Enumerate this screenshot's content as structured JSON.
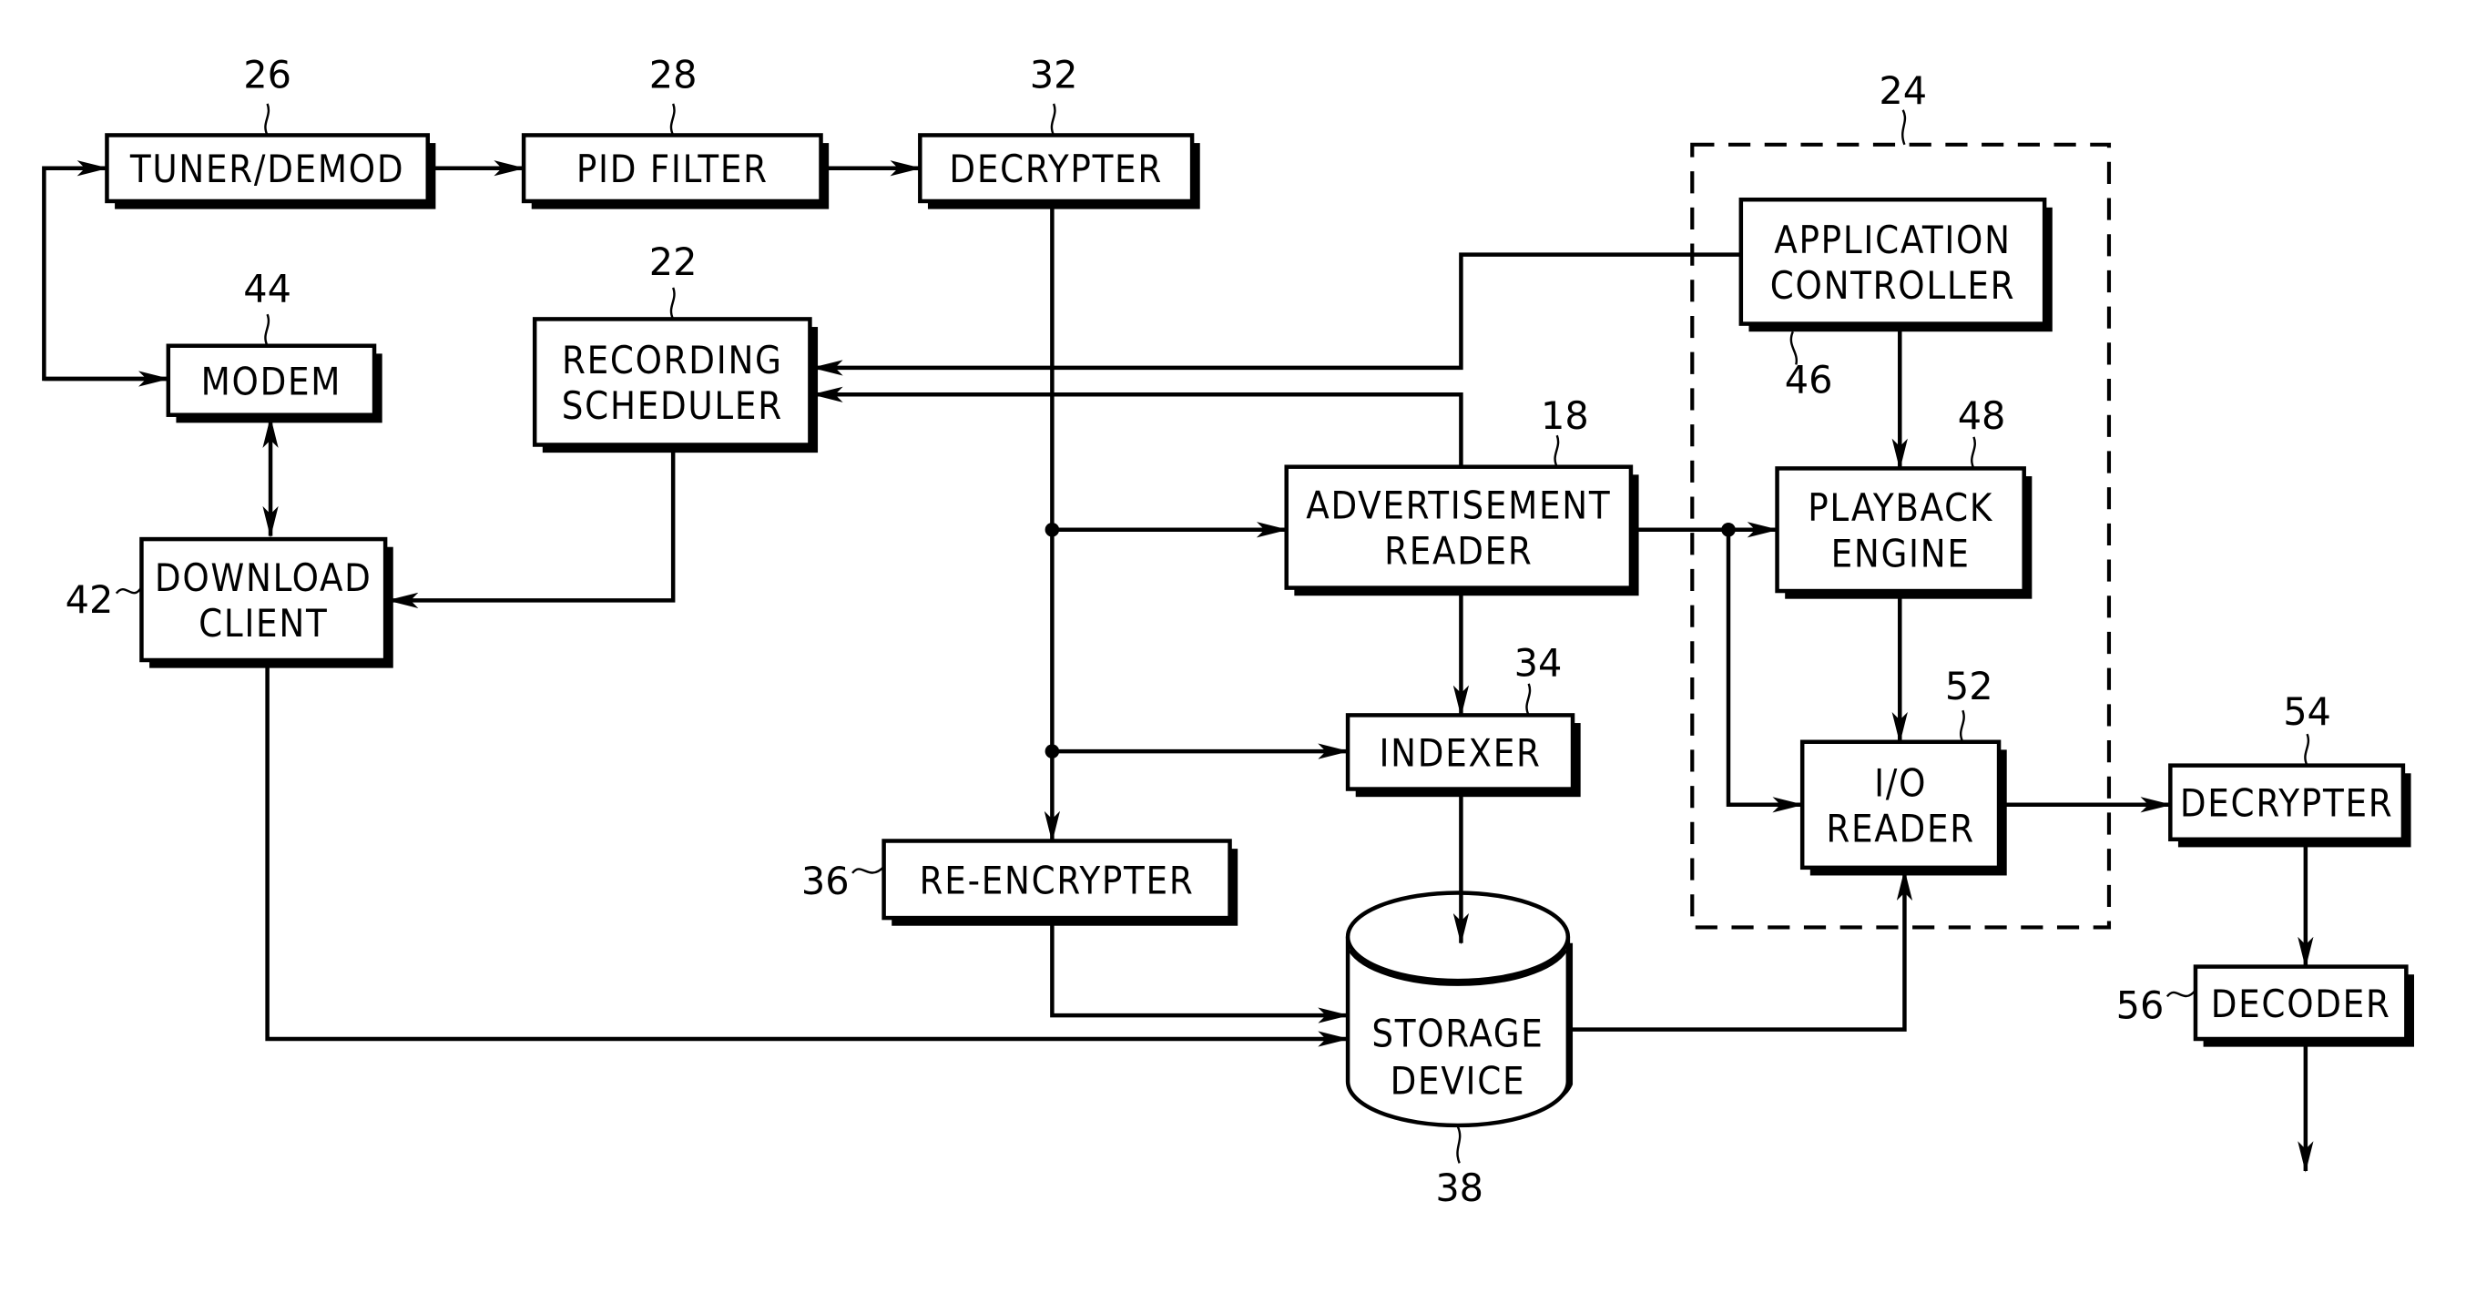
{
  "figure": {
    "blocks": [
      {
        "id": "tuner",
        "ref": "26",
        "lines": [
          "TUNER/DEMOD"
        ]
      },
      {
        "id": "pid",
        "ref": "28",
        "lines": [
          "PID FILTER"
        ]
      },
      {
        "id": "decrypter1",
        "ref": "32",
        "lines": [
          "DECRYPTER"
        ]
      },
      {
        "id": "modem",
        "ref": "44",
        "lines": [
          "MODEM"
        ]
      },
      {
        "id": "scheduler",
        "ref": "22",
        "lines": [
          "RECORDING",
          "SCHEDULER"
        ]
      },
      {
        "id": "download",
        "ref": "42",
        "lines": [
          "DOWNLOAD",
          "CLIENT"
        ]
      },
      {
        "id": "appctrl",
        "ref": "46",
        "lines": [
          "APPLICATION",
          "CONTROLLER"
        ]
      },
      {
        "id": "adreader",
        "ref": "18",
        "lines": [
          "ADVERTISEMENT",
          "READER"
        ]
      },
      {
        "id": "playback",
        "ref": "48",
        "lines": [
          "PLAYBACK",
          "ENGINE"
        ]
      },
      {
        "id": "indexer",
        "ref": "34",
        "lines": [
          "INDEXER"
        ]
      },
      {
        "id": "ioreader",
        "ref": "52",
        "lines": [
          "I/O",
          "READER"
        ]
      },
      {
        "id": "decrypter2",
        "ref": "54",
        "lines": [
          "DECRYPTER"
        ]
      },
      {
        "id": "reencrypter",
        "ref": "36",
        "lines": [
          "RE-ENCRYPTER"
        ]
      },
      {
        "id": "decoder",
        "ref": "56",
        "lines": [
          "DECODER"
        ]
      },
      {
        "id": "storage",
        "ref": "38",
        "lines": [
          "STORAGE",
          "DEVICE"
        ]
      }
    ],
    "group": {
      "ref": "24",
      "style": "dashed",
      "contains": [
        "appctrl",
        "playback",
        "ioreader"
      ]
    },
    "connections": [
      {
        "from": "tuner",
        "to": "pid",
        "arrow": "end"
      },
      {
        "from": "pid",
        "to": "decrypter1",
        "arrow": "end"
      },
      {
        "from": "modem",
        "to": "tuner",
        "arrow": "end"
      },
      {
        "from": "tuner",
        "to": "modem",
        "arrow": "end"
      },
      {
        "from": "modem",
        "to": "download",
        "arrow": "both"
      },
      {
        "from": "scheduler",
        "to": "download",
        "arrow": "end"
      },
      {
        "from": "appctrl",
        "to": "scheduler",
        "arrow": "end"
      },
      {
        "from": "adreader",
        "to": "scheduler",
        "arrow": "end"
      },
      {
        "from": "decrypter1",
        "to": "adreader",
        "arrow": "end"
      },
      {
        "from": "decrypter1",
        "to": "indexer",
        "arrow": "end"
      },
      {
        "from": "decrypter1",
        "to": "reencrypter",
        "arrow": "end"
      },
      {
        "from": "adreader",
        "to": "indexer",
        "arrow": "end"
      },
      {
        "from": "indexer",
        "to": "storage",
        "arrow": "end"
      },
      {
        "from": "reencrypter",
        "to": "storage",
        "arrow": "end"
      },
      {
        "from": "download",
        "to": "storage",
        "arrow": "end"
      },
      {
        "from": "appctrl",
        "to": "playback",
        "arrow": "end"
      },
      {
        "from": "adreader",
        "to": "playback",
        "arrow": "end"
      },
      {
        "from": "adreader",
        "to": "ioreader",
        "arrow": "end"
      },
      {
        "from": "playback",
        "to": "ioreader",
        "arrow": "end"
      },
      {
        "from": "storage",
        "to": "ioreader",
        "arrow": "end"
      },
      {
        "from": "ioreader",
        "to": "decrypter2",
        "arrow": "end"
      },
      {
        "from": "decrypter2",
        "to": "decoder",
        "arrow": "end"
      },
      {
        "from": "decoder",
        "to": "output",
        "arrow": "end"
      }
    ]
  }
}
